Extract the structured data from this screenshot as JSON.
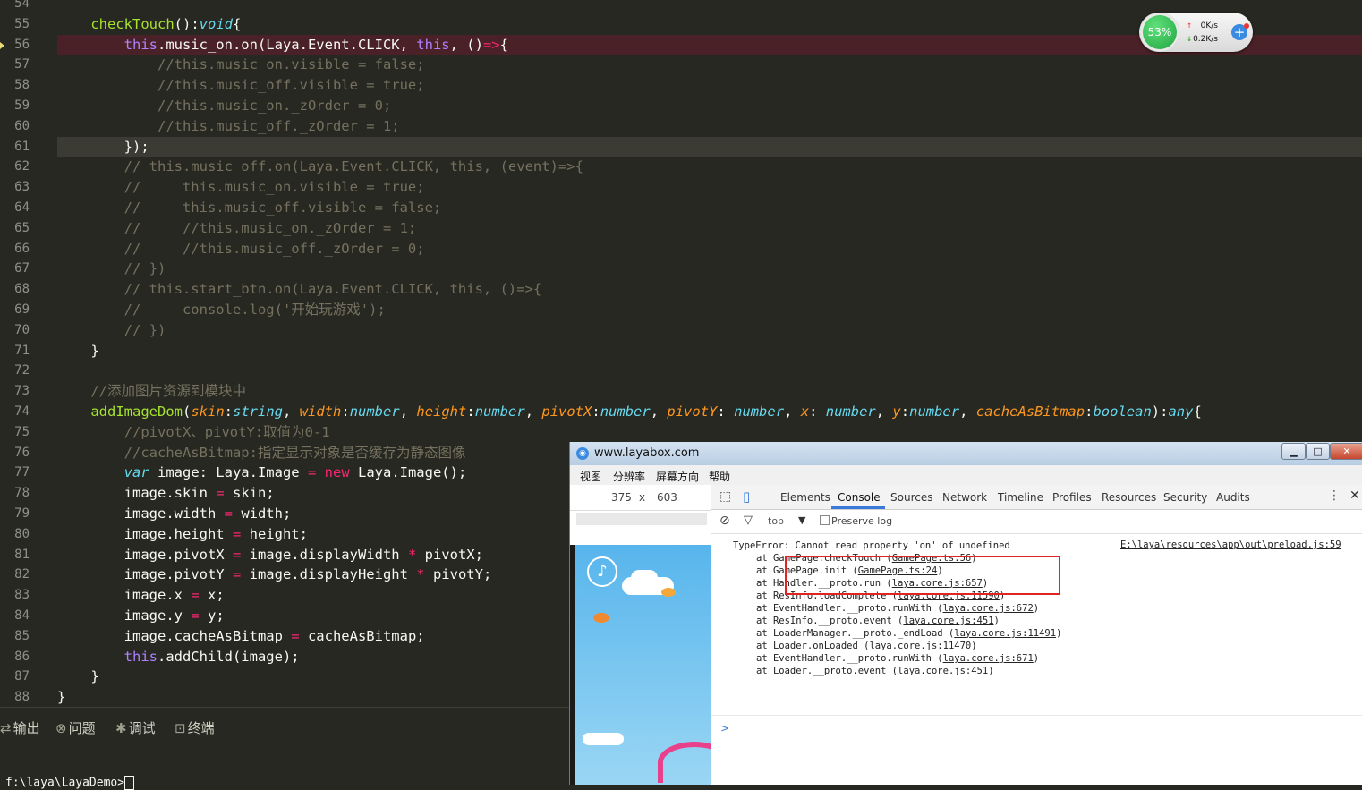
{
  "editor": {
    "lines": [
      {
        "num": "54",
        "tokens": []
      },
      {
        "num": "55",
        "tokens": [
          [
            "n",
            "    "
          ],
          [
            "f",
            "checkTouch"
          ],
          [
            "n",
            "():"
          ],
          [
            "k",
            "void"
          ],
          [
            "n",
            "{"
          ]
        ]
      },
      {
        "num": "56",
        "state": "err",
        "tokens": [
          [
            "n",
            "        "
          ],
          [
            "th",
            "this"
          ],
          [
            "n",
            ".music_on.on(Laya.Event.CLICK, "
          ],
          [
            "th",
            "this"
          ],
          [
            "n",
            ", ()"
          ],
          [
            "o",
            "=>"
          ],
          [
            "n",
            "{"
          ]
        ]
      },
      {
        "num": "57",
        "tokens": [
          [
            "c",
            "            //this.music_on.visible = false;"
          ]
        ]
      },
      {
        "num": "58",
        "tokens": [
          [
            "c",
            "            //this.music_off.visible = true;"
          ]
        ]
      },
      {
        "num": "59",
        "tokens": [
          [
            "c",
            "            //this.music_on._zOrder = 0;"
          ]
        ]
      },
      {
        "num": "60",
        "tokens": [
          [
            "c",
            "            //this.music_off._zOrder = 1;"
          ]
        ]
      },
      {
        "num": "61",
        "state": "cur",
        "tokens": [
          [
            "n",
            "        });"
          ]
        ]
      },
      {
        "num": "62",
        "tokens": [
          [
            "c",
            "        // this.music_off.on(Laya.Event.CLICK, this, (event)=>{"
          ]
        ]
      },
      {
        "num": "63",
        "tokens": [
          [
            "c",
            "        //     this.music_on.visible = true;"
          ]
        ]
      },
      {
        "num": "64",
        "tokens": [
          [
            "c",
            "        //     this.music_off.visible = false;"
          ]
        ]
      },
      {
        "num": "65",
        "tokens": [
          [
            "c",
            "        //     //this.music_on._zOrder = 1;"
          ]
        ]
      },
      {
        "num": "66",
        "tokens": [
          [
            "c",
            "        //     //this.music_off._zOrder = 0;"
          ]
        ]
      },
      {
        "num": "67",
        "tokens": [
          [
            "c",
            "        // })"
          ]
        ]
      },
      {
        "num": "68",
        "tokens": [
          [
            "c",
            "        // this.start_btn.on(Laya.Event.CLICK, this, ()=>{"
          ]
        ]
      },
      {
        "num": "69",
        "tokens": [
          [
            "c",
            "        //     console.log('开始玩游戏');"
          ]
        ]
      },
      {
        "num": "70",
        "tokens": [
          [
            "c",
            "        // })"
          ]
        ]
      },
      {
        "num": "71",
        "tokens": [
          [
            "n",
            "    }"
          ]
        ]
      },
      {
        "num": "72",
        "tokens": []
      },
      {
        "num": "73",
        "tokens": [
          [
            "c",
            "    //添加图片资源到模块中"
          ]
        ]
      },
      {
        "num": "74",
        "tokens": [
          [
            "n",
            "    "
          ],
          [
            "f",
            "addImageDom"
          ],
          [
            "n",
            "("
          ],
          [
            "p",
            "skin"
          ],
          [
            "n",
            ":"
          ],
          [
            "y",
            "string"
          ],
          [
            "n",
            ", "
          ],
          [
            "p",
            "width"
          ],
          [
            "n",
            ":"
          ],
          [
            "y",
            "number"
          ],
          [
            "n",
            ", "
          ],
          [
            "p",
            "height"
          ],
          [
            "n",
            ":"
          ],
          [
            "y",
            "number"
          ],
          [
            "n",
            ", "
          ],
          [
            "p",
            "pivotX"
          ],
          [
            "n",
            ":"
          ],
          [
            "y",
            "number"
          ],
          [
            "n",
            ", "
          ],
          [
            "p",
            "pivotY"
          ],
          [
            "n",
            ": "
          ],
          [
            "y",
            "number"
          ],
          [
            "n",
            ", "
          ],
          [
            "p",
            "x"
          ],
          [
            "n",
            ": "
          ],
          [
            "y",
            "number"
          ],
          [
            "n",
            ", "
          ],
          [
            "p",
            "y"
          ],
          [
            "n",
            ":"
          ],
          [
            "y",
            "number"
          ],
          [
            "n",
            ", "
          ],
          [
            "p",
            "cacheAsBitmap"
          ],
          [
            "n",
            ":"
          ],
          [
            "y",
            "boolean"
          ],
          [
            "n",
            "):"
          ],
          [
            "y",
            "any"
          ],
          [
            "n",
            "{"
          ]
        ]
      },
      {
        "num": "75",
        "tokens": [
          [
            "c",
            "        //pivotX、pivotY:取值为0-1"
          ]
        ]
      },
      {
        "num": "76",
        "tokens": [
          [
            "c",
            "        //cacheAsBitmap:指定显示对象是否缓存为静态图像"
          ]
        ]
      },
      {
        "num": "77",
        "tokens": [
          [
            "n",
            "        "
          ],
          [
            "k",
            "var"
          ],
          [
            "n",
            " image: Laya.Image "
          ],
          [
            "o",
            "="
          ],
          [
            "n",
            " "
          ],
          [
            "o",
            "new"
          ],
          [
            "n",
            " Laya.Image();"
          ]
        ]
      },
      {
        "num": "78",
        "tokens": [
          [
            "n",
            "        image.skin "
          ],
          [
            "o",
            "="
          ],
          [
            "n",
            " skin;"
          ]
        ]
      },
      {
        "num": "79",
        "tokens": [
          [
            "n",
            "        image.width "
          ],
          [
            "o",
            "="
          ],
          [
            "n",
            " width;"
          ]
        ]
      },
      {
        "num": "80",
        "tokens": [
          [
            "n",
            "        image.height "
          ],
          [
            "o",
            "="
          ],
          [
            "n",
            " height;"
          ]
        ]
      },
      {
        "num": "81",
        "tokens": [
          [
            "n",
            "        image.pivotX "
          ],
          [
            "o",
            "="
          ],
          [
            "n",
            " image.displayWidth "
          ],
          [
            "o",
            "*"
          ],
          [
            "n",
            " pivotX;"
          ]
        ]
      },
      {
        "num": "82",
        "tokens": [
          [
            "n",
            "        image.pivotY "
          ],
          [
            "o",
            "="
          ],
          [
            "n",
            " image.displayHeight "
          ],
          [
            "o",
            "*"
          ],
          [
            "n",
            " pivotY;"
          ]
        ]
      },
      {
        "num": "83",
        "tokens": [
          [
            "n",
            "        image.x "
          ],
          [
            "o",
            "="
          ],
          [
            "n",
            " x;"
          ]
        ]
      },
      {
        "num": "84",
        "tokens": [
          [
            "n",
            "        image.y "
          ],
          [
            "o",
            "="
          ],
          [
            "n",
            " y;"
          ]
        ]
      },
      {
        "num": "85",
        "tokens": [
          [
            "n",
            "        image.cacheAsBitmap "
          ],
          [
            "o",
            "="
          ],
          [
            "n",
            " cacheAsBitmap;"
          ]
        ]
      },
      {
        "num": "86",
        "tokens": [
          [
            "n",
            "        "
          ],
          [
            "th",
            "this"
          ],
          [
            "n",
            ".addChild(image);"
          ]
        ]
      },
      {
        "num": "87",
        "tokens": [
          [
            "n",
            "    }"
          ]
        ]
      },
      {
        "num": "88",
        "tokens": [
          [
            "n",
            "}"
          ]
        ]
      }
    ]
  },
  "panel": {
    "tabs": [
      {
        "icon": "⇄",
        "label": "输出"
      },
      {
        "icon": "⊗",
        "label": "问题"
      },
      {
        "icon": "✱",
        "label": "调试"
      },
      {
        "icon": "⊡",
        "label": "终端"
      }
    ],
    "terminal_line": "f:\\laya\\LayaDemo>"
  },
  "network_widget": {
    "cpu": "53%",
    "upload": "0K/s",
    "download": "0.2K/s"
  },
  "browser": {
    "title": "www.layabox.com",
    "menu": [
      "视图",
      "分辨率",
      "屏幕方向",
      "帮助"
    ],
    "device": {
      "width": "375",
      "x": "x",
      "height": "603"
    },
    "devtools": {
      "tabs": [
        "Elements",
        "Console",
        "Sources",
        "Network",
        "Timeline",
        "Profiles",
        "Resources",
        "Security",
        "Audits"
      ],
      "active_tab": "Console",
      "context": "top",
      "preserve_log": "Preserve log",
      "error_line": "TypeError: Cannot read property 'on' of undefined",
      "error_source": "E:\\laya\\resources\\app\\out\\preload.js:59",
      "stack": [
        {
          "fn": "at GamePage.checkTouch (",
          "loc": "GamePage.ts:56"
        },
        {
          "fn": "at GamePage.init (",
          "loc": "GamePage.ts:24"
        },
        {
          "fn": "at Handler.__proto.run (",
          "loc": "laya.core.js:657"
        },
        {
          "fn": "at ResInfo.loadComplete (",
          "loc": "laya.core.js:11590"
        },
        {
          "fn": "at EventHandler.__proto.runWith (",
          "loc": "laya.core.js:672"
        },
        {
          "fn": "at ResInfo.__proto.event (",
          "loc": "laya.core.js:451"
        },
        {
          "fn": "at LoaderManager.__proto._endLoad (",
          "loc": "laya.core.js:11491"
        },
        {
          "fn": "at Loader.onLoaded (",
          "loc": "laya.core.js:11470"
        },
        {
          "fn": "at EventHandler.__proto.runWith (",
          "loc": "laya.core.js:671"
        },
        {
          "fn": "at Loader.__proto.event (",
          "loc": "laya.core.js:451"
        }
      ],
      "prompt": ">"
    }
  }
}
